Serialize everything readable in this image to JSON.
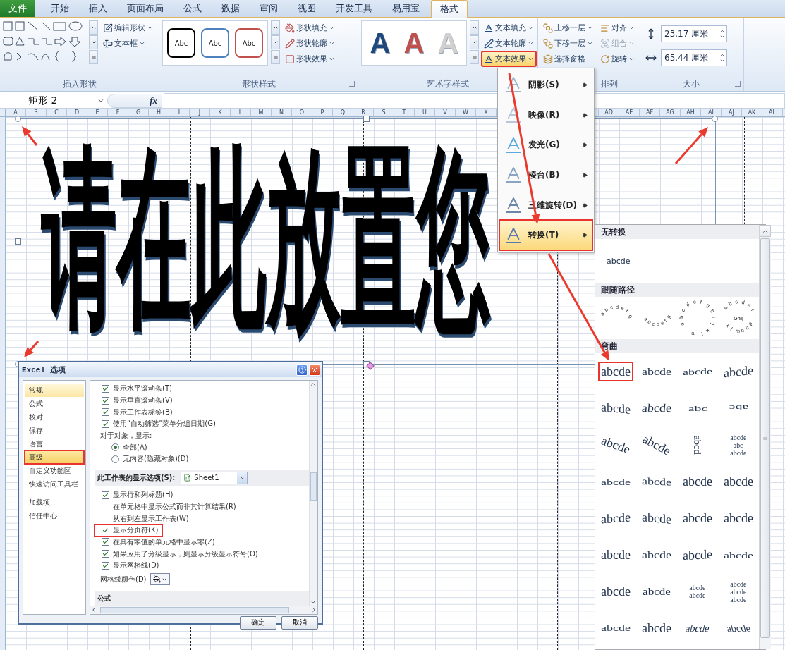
{
  "tabs": [
    {
      "label": "文件",
      "kind": "file",
      "selected": false
    },
    {
      "label": "开始",
      "kind": "tab",
      "selected": false
    },
    {
      "label": "插入",
      "kind": "tab",
      "selected": false
    },
    {
      "label": "页面布局",
      "kind": "tab",
      "selected": false
    },
    {
      "label": "公式",
      "kind": "tab",
      "selected": false
    },
    {
      "label": "数据",
      "kind": "tab",
      "selected": false
    },
    {
      "label": "审阅",
      "kind": "tab",
      "selected": false
    },
    {
      "label": "视图",
      "kind": "tab",
      "selected": false
    },
    {
      "label": "开发工具",
      "kind": "tab",
      "selected": false
    },
    {
      "label": "易用宝",
      "kind": "tab",
      "selected": false
    },
    {
      "label": "格式",
      "kind": "tab",
      "selected": true
    }
  ],
  "ribbon": {
    "insert_shapes": {
      "label": "插入形状",
      "buttons": [
        "编辑形状",
        "文本框"
      ]
    },
    "shape_styles": {
      "label": "形状样式",
      "styles": [
        {
          "text": "Abc",
          "color": "#000000"
        },
        {
          "text": "Abc",
          "color": "#4f81bd"
        },
        {
          "text": "Abc",
          "color": "#c0504d"
        }
      ],
      "buttons": [
        "形状填充",
        "形状轮廓",
        "形状效果"
      ]
    },
    "wordart_styles": {
      "label": "艺术字样式",
      "styles": [
        {
          "text": "A",
          "color": "#1f497d"
        },
        {
          "text": "A",
          "color": "#c0504d"
        },
        {
          "text": "A",
          "color": "#d0d0d0"
        }
      ],
      "buttons": [
        {
          "label": "文本填充",
          "active": false,
          "marked": false
        },
        {
          "label": "文本轮廓",
          "active": false,
          "marked": false
        },
        {
          "label": "文本效果",
          "active": true,
          "marked": true
        }
      ]
    },
    "arrange": {
      "label": "排列",
      "buttons": [
        {
          "label": "上移一层",
          "disabled": false,
          "dropdown": true
        },
        {
          "label": "下移一层",
          "disabled": false,
          "dropdown": true
        },
        {
          "label": "选择窗格",
          "disabled": false,
          "dropdown": false
        },
        {
          "label": "对齐",
          "disabled": false,
          "dropdown": true
        },
        {
          "label": "组合",
          "disabled": true,
          "dropdown": true
        },
        {
          "label": "旋转",
          "disabled": false,
          "dropdown": true
        }
      ]
    },
    "size": {
      "label": "大小",
      "fields": [
        {
          "kind": "height",
          "value": "23.17 厘米"
        },
        {
          "kind": "width",
          "value": "65.44 厘米"
        }
      ]
    }
  },
  "formula_bar": {
    "name_box": "矩形 2",
    "fx": "fx"
  },
  "columns_left": [
    "A",
    "B",
    "C",
    "D",
    "E",
    "F",
    "G",
    "H",
    "I",
    "J",
    "K",
    "L",
    "M",
    "N",
    "O",
    "P",
    "Q",
    "R",
    "S",
    "T",
    "U",
    "V",
    "W",
    "X"
  ],
  "columns_right": [
    "AD",
    "AE",
    "AF",
    "AG",
    "AH",
    "AI",
    "AJ",
    "AK",
    "AL"
  ],
  "wordart": {
    "text": "请在此放置您"
  },
  "menu": {
    "items": [
      {
        "label": "阴影(S)",
        "highlighted": false,
        "marked": false
      },
      {
        "label": "映像(R)",
        "highlighted": false,
        "marked": false
      },
      {
        "label": "发光(G)",
        "highlighted": false,
        "marked": false
      },
      {
        "label": "棱台(B)",
        "highlighted": false,
        "marked": false
      },
      {
        "label": "三维旋转(D)",
        "highlighted": false,
        "marked": false
      },
      {
        "label": "转换(T)",
        "highlighted": true,
        "marked": true
      }
    ]
  },
  "gallery": {
    "sections": [
      {
        "title": "无转换",
        "kind": "plain",
        "items": [
          {
            "kind": "plain",
            "lines": [
              "abcde"
            ],
            "marked": false
          }
        ]
      },
      {
        "title": "跟随路径",
        "kind": "path",
        "items": [
          {
            "kind": "arch-up",
            "lines": [
              "abcdefg"
            ],
            "marked": false
          },
          {
            "kind": "arch-down",
            "lines": [
              "abcdefg"
            ],
            "marked": false
          },
          {
            "kind": "circle",
            "lines": [
              "abcdefghijklm"
            ],
            "marked": false
          },
          {
            "kind": "button",
            "lines": [
              "abcdef",
              "Ghij",
              "klmnop"
            ],
            "marked": false
          }
        ]
      },
      {
        "title": "弯曲",
        "kind": "warp",
        "items": [
          {
            "kind": "warp",
            "lines": [
              "abcde"
            ],
            "marked": true
          },
          {
            "kind": "warp",
            "lines": [
              "abcde"
            ],
            "marked": false
          },
          {
            "kind": "warp",
            "lines": [
              "abcde"
            ],
            "marked": false
          },
          {
            "kind": "warp",
            "lines": [
              "abcde"
            ],
            "marked": false
          },
          {
            "kind": "warp",
            "lines": [
              "abcde"
            ],
            "marked": false
          },
          {
            "kind": "warp",
            "lines": [
              "abcde"
            ],
            "marked": false
          },
          {
            "kind": "warp",
            "lines": [
              "abc"
            ],
            "marked": false
          },
          {
            "kind": "warp",
            "lines": [
              "abc"
            ],
            "marked": false
          },
          {
            "kind": "warp",
            "lines": [
              "abcde"
            ],
            "marked": false
          },
          {
            "kind": "warp",
            "lines": [
              "abcde"
            ],
            "marked": false
          },
          {
            "kind": "warp",
            "lines": [
              "abcd"
            ],
            "marked": false
          },
          {
            "kind": "warp",
            "lines": [
              "abcde",
              "abc",
              "abcde"
            ],
            "marked": false
          },
          {
            "kind": "warp",
            "lines": [
              "abcde"
            ],
            "marked": false
          },
          {
            "kind": "warp",
            "lines": [
              "abcde"
            ],
            "marked": false
          },
          {
            "kind": "warp",
            "lines": [
              "abcde"
            ],
            "marked": false
          },
          {
            "kind": "warp",
            "lines": [
              "abcde"
            ],
            "marked": false
          },
          {
            "kind": "warp",
            "lines": [
              "abcde"
            ],
            "marked": false
          },
          {
            "kind": "warp",
            "lines": [
              "abcde"
            ],
            "marked": false
          },
          {
            "kind": "warp",
            "lines": [
              "abcde"
            ],
            "marked": false
          },
          {
            "kind": "warp",
            "lines": [
              "abcde"
            ],
            "marked": false
          },
          {
            "kind": "warp",
            "lines": [
              "abcde"
            ],
            "marked": false
          },
          {
            "kind": "warp",
            "lines": [
              "abcde"
            ],
            "marked": false
          },
          {
            "kind": "warp",
            "lines": [
              "abcde"
            ],
            "marked": false
          },
          {
            "kind": "warp",
            "lines": [
              "abcde"
            ],
            "marked": false
          },
          {
            "kind": "warp",
            "lines": [
              "abcde"
            ],
            "marked": false
          },
          {
            "kind": "warp",
            "lines": [
              "abcde"
            ],
            "marked": false
          },
          {
            "kind": "warp",
            "lines": [
              "abcde",
              "abcde"
            ],
            "marked": false
          },
          {
            "kind": "warp",
            "lines": [
              "abcde",
              "abcde",
              "abcde"
            ],
            "marked": false
          },
          {
            "kind": "warp",
            "lines": [
              "abcde"
            ],
            "marked": false
          },
          {
            "kind": "warp",
            "lines": [
              "abcde"
            ],
            "marked": false
          },
          {
            "kind": "warp",
            "lines": [
              "abcde"
            ],
            "marked": false
          },
          {
            "kind": "warp",
            "lines": [
              "abcde"
            ],
            "marked": false
          }
        ]
      }
    ]
  },
  "dialog": {
    "title": "Excel 选项",
    "nav_groups": [
      {
        "items": [
          {
            "label": "常规",
            "selected": false,
            "hovered": true,
            "marked": false
          },
          {
            "label": "公式",
            "selected": false,
            "hovered": false,
            "marked": false
          },
          {
            "label": "校对",
            "selected": false,
            "hovered": false,
            "marked": false
          },
          {
            "label": "保存",
            "selected": false,
            "hovered": false,
            "marked": false
          },
          {
            "label": "语言",
            "selected": false,
            "hovered": false,
            "marked": false
          },
          {
            "label": "高级",
            "selected": true,
            "hovered": false,
            "marked": true
          },
          {
            "label": "自定义功能区",
            "selected": false,
            "hovered": false,
            "marked": false
          },
          {
            "label": "快速访问工具栏",
            "selected": false,
            "hovered": false,
            "marked": false
          }
        ]
      },
      {
        "items": [
          {
            "label": "加载项",
            "selected": false,
            "hovered": false,
            "marked": false
          },
          {
            "label": "信任中心",
            "selected": false,
            "hovered": false,
            "marked": false
          }
        ]
      }
    ],
    "options": [
      {
        "kind": "checkbox",
        "label": "显示水平滚动条(T)",
        "checked": true,
        "marked": false
      },
      {
        "kind": "checkbox",
        "label": "显示垂直滚动条(V)",
        "checked": true,
        "marked": false
      },
      {
        "kind": "checkbox",
        "label": "显示工作表标签(B)",
        "checked": true,
        "marked": false
      },
      {
        "kind": "checkbox",
        "label": "使用“自动筛选”菜单分组日期(G)",
        "checked": true,
        "marked": false
      },
      {
        "kind": "label",
        "label": "对于对象，显示:"
      },
      {
        "kind": "radio",
        "label": "全部(A)",
        "selected": true
      },
      {
        "kind": "radio",
        "label": "无内容(隐藏对象)(D)",
        "selected": false
      },
      {
        "kind": "section",
        "label": "此工作表的显示选项(S):",
        "value": "Sheet1"
      },
      {
        "kind": "checkbox",
        "label": "显示行和列标题(H)",
        "checked": true,
        "marked": false
      },
      {
        "kind": "checkbox",
        "label": "在单元格中显示公式而非其计算结果(R)",
        "checked": false,
        "marked": false
      },
      {
        "kind": "checkbox",
        "label": "从右到左显示工作表(W)",
        "checked": false,
        "marked": false
      },
      {
        "kind": "checkbox",
        "label": "显示分页符(K)",
        "checked": true,
        "marked": true
      },
      {
        "kind": "checkbox",
        "label": "在具有零值的单元格中显示零(Z)",
        "checked": true,
        "marked": false
      },
      {
        "kind": "checkbox",
        "label": "如果应用了分级显示，则显示分级显示符号(O)",
        "checked": true,
        "marked": false
      },
      {
        "kind": "checkbox",
        "label": "显示网格线(D)",
        "checked": true,
        "marked": false
      },
      {
        "kind": "color",
        "label": "网格线颜色(D)"
      },
      {
        "kind": "header",
        "label": "公式"
      }
    ],
    "buttons": [
      "确定",
      "取消"
    ]
  }
}
